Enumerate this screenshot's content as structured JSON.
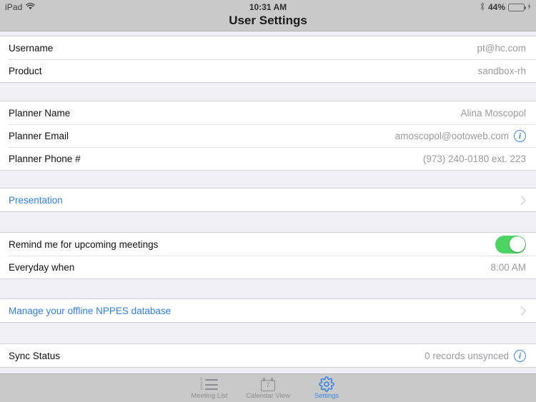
{
  "status_bar": {
    "device": "iPad",
    "wifi_icon": "wifi-icon",
    "time": "10:31 AM",
    "bluetooth_icon": "bluetooth-icon",
    "battery_percent": "44%",
    "battery_icon": "battery-icon",
    "charging_icon": "charging-bolt-icon",
    "battery_level": 44,
    "battery_color": "#4CD462"
  },
  "nav": {
    "title": "User Settings"
  },
  "colors": {
    "link": "#2f7fe8",
    "accent": "#3b87e8",
    "toggle_on": "#4CD462",
    "background": "#EFEFF4",
    "bar": "#C9C9C9"
  },
  "sections": [
    {
      "rows": [
        {
          "label": "Username",
          "value": "pt@hc.com"
        },
        {
          "label": "Product",
          "value": "sandbox-rh"
        }
      ]
    },
    {
      "rows": [
        {
          "label": "Planner Name",
          "value": "Alina Moscopol"
        },
        {
          "label": "Planner Email",
          "value": "amoscopol@ootoweb.com",
          "info": "info-icon"
        },
        {
          "label": "Planner Phone #",
          "value": "(973) 240-0180 ext. 223"
        }
      ]
    },
    {
      "rows": [
        {
          "label": "Presentation",
          "link": true,
          "chevron": true
        }
      ]
    },
    {
      "rows": [
        {
          "label": "Remind me for upcoming meetings",
          "toggle": true,
          "toggle_on": true
        },
        {
          "label": "Everyday when",
          "value": "8:00 AM"
        }
      ]
    },
    {
      "rows": [
        {
          "label": "Manage your offline NPPES database",
          "link": true,
          "chevron": true
        }
      ]
    },
    {
      "rows": [
        {
          "label": "Sync Status",
          "value": "0 records unsynced",
          "info": "info-icon"
        }
      ]
    }
  ],
  "tabs": [
    {
      "label": "Meeting List",
      "icon": "numbered-list-icon",
      "active": false
    },
    {
      "label": "Calendar View",
      "icon": "calendar-icon",
      "calendar_day": "7",
      "active": false
    },
    {
      "label": "Settings",
      "icon": "gear-icon",
      "active": true
    }
  ]
}
